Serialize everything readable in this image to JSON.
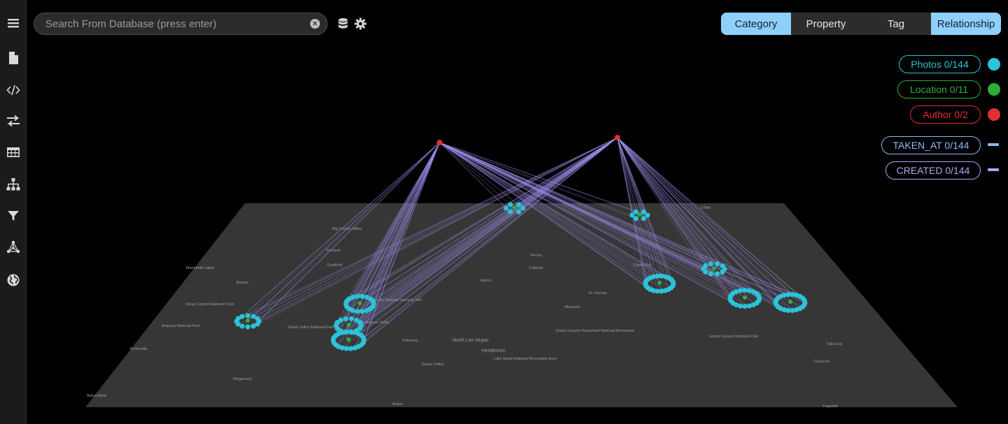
{
  "search": {
    "placeholder": "Search From Database (press enter)",
    "value": ""
  },
  "toolbar": {
    "database_icon": "database-icon",
    "settings_icon": "gear-icon",
    "clear_icon": "clear-search-icon"
  },
  "sidebar": {
    "items": [
      {
        "name": "menu",
        "icon": "hamburger-menu-icon"
      },
      {
        "name": "document",
        "icon": "file-icon"
      },
      {
        "name": "code",
        "icon": "code-icon"
      },
      {
        "name": "transfer",
        "icon": "arrows-exchange-icon"
      },
      {
        "name": "table",
        "icon": "table-icon"
      },
      {
        "name": "hierarchy",
        "icon": "sitemap-icon"
      },
      {
        "name": "filter",
        "icon": "filter-icon"
      },
      {
        "name": "graph",
        "icon": "graph-nodes-icon"
      },
      {
        "name": "globe",
        "icon": "globe-icon"
      }
    ]
  },
  "tabs": [
    {
      "label": "Category",
      "active": true
    },
    {
      "label": "Property",
      "active": false
    },
    {
      "label": "Tag",
      "active": false
    },
    {
      "label": "Relationship",
      "active": true
    }
  ],
  "legend": {
    "nodes": [
      {
        "label": "Photos 0/144",
        "color": "#2bc3d8"
      },
      {
        "label": "Location 0/11",
        "color": "#2fae35"
      },
      {
        "label": "Author 0/2",
        "color": "#e03131"
      }
    ],
    "edges": [
      {
        "label": "TAKEN_AT 0/144",
        "color": "#8fb8f6"
      },
      {
        "label": "CREATED 0/144",
        "color": "#b0a6ef"
      }
    ]
  },
  "colors": {
    "photo": "#2bc3d8",
    "location": "#2fae35",
    "author": "#e03131",
    "edge": "#9b90e8",
    "map": "#363636",
    "tab_active": "#8fd0fb"
  },
  "map": {
    "labels": [
      "Big Smoky Valley",
      "Kings Canyon National Park",
      "Sequoia National Park",
      "Porterville",
      "Bakersfield",
      "Ridgecrest",
      "Death Valley National Park",
      "Amargosa Valley",
      "Pahrump",
      "North Las Vegas",
      "Henderson",
      "Lake Mead National Recreation Area",
      "Sandy Valley",
      "Mesquite",
      "Grand Canyon-Parashant National Monument",
      "St. George",
      "Cedar City",
      "Pioche",
      "Caliente",
      "Alamo",
      "Nevada National Security Site",
      "Goldfield",
      "Tonopah",
      "Bishop",
      "Mammoth Lakes",
      "Grand Canyon National Park",
      "Tuba City",
      "Cameron",
      "Baker",
      "UTAH",
      "Flagstaff"
    ]
  }
}
